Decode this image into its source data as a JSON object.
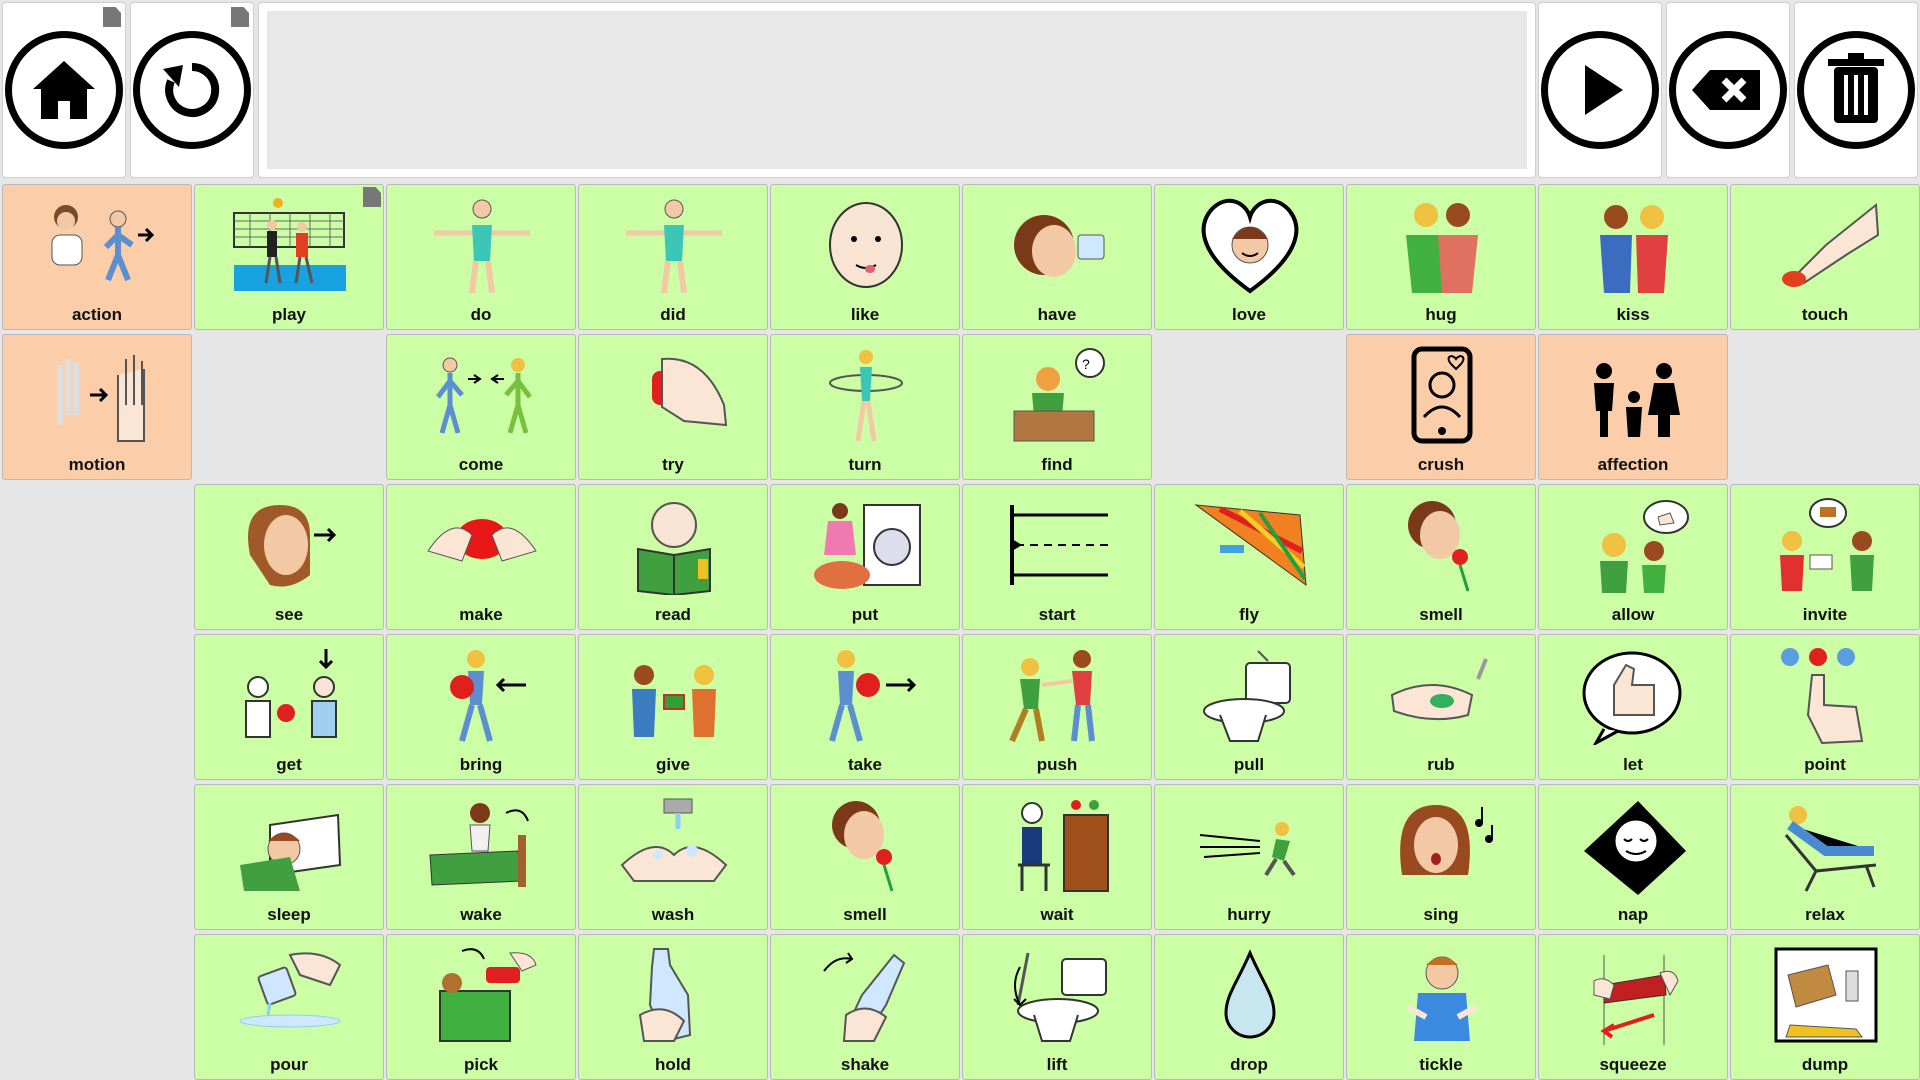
{
  "toolbar": {
    "home_icon": "home-icon",
    "back_icon": "undo-icon",
    "speak_icon": "play-icon",
    "backspace_icon": "backspace-icon",
    "clear_icon": "trash-icon",
    "message": ""
  },
  "colors": {
    "green_tile": "#ccfea6",
    "peach_tile": "#fbcda9",
    "background": "#e6e6e6"
  },
  "cells": {
    "action": "action",
    "play": "play",
    "do": "do",
    "did": "did",
    "like": "like",
    "have": "have",
    "love": "love",
    "hug": "hug",
    "kiss": "kiss",
    "touch": "touch",
    "motion": "motion",
    "come": "come",
    "try": "try",
    "turn": "turn",
    "find": "find",
    "crush": "crush",
    "affection": "affection",
    "see": "see",
    "make": "make",
    "read": "read",
    "put": "put",
    "start": "start",
    "fly": "fly",
    "smell1": "smell",
    "allow": "allow",
    "invite": "invite",
    "get": "get",
    "bring": "bring",
    "give": "give",
    "take": "take",
    "push": "push",
    "pull": "pull",
    "rub": "rub",
    "let": "let",
    "point": "point",
    "sleep": "sleep",
    "wake": "wake",
    "wash": "wash",
    "smell2": "smell",
    "wait": "wait",
    "hurry": "hurry",
    "sing": "sing",
    "nap": "nap",
    "relax": "relax",
    "pour": "pour",
    "pick": "pick",
    "hold": "hold",
    "shake": "shake",
    "lift": "lift",
    "drop": "drop",
    "tickle": "tickle",
    "squeeze": "squeeze",
    "dump": "dump"
  }
}
